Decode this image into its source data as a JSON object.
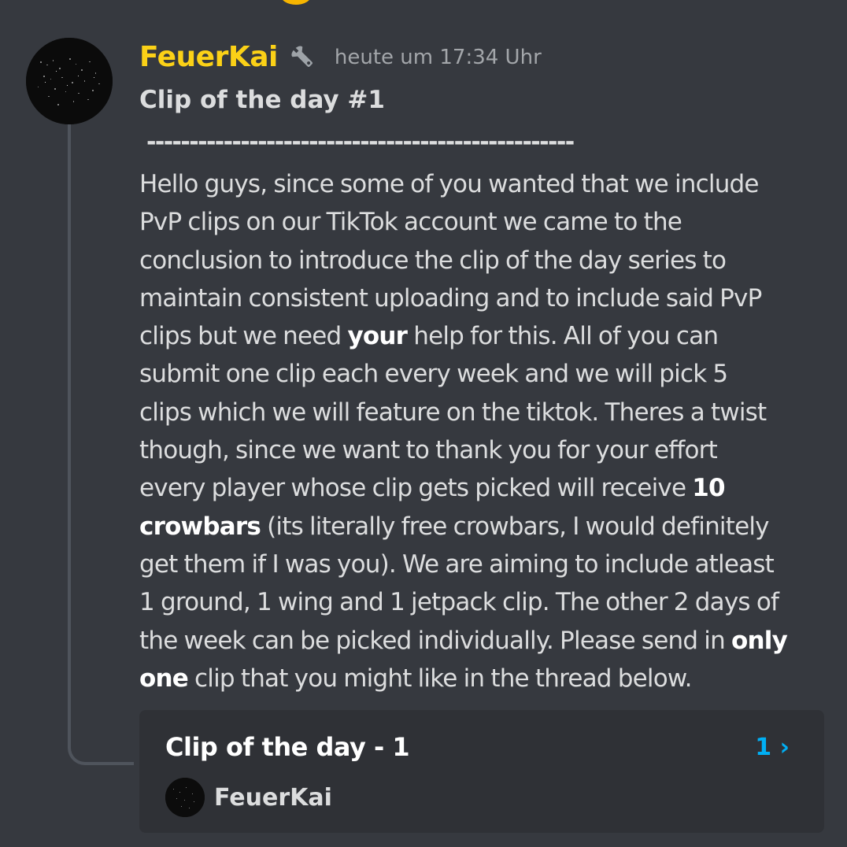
{
  "message": {
    "username": "FeuerKai",
    "role_icon": "wrench-icon",
    "timestamp": "heute um 17:34 Uhr",
    "title": "Clip of the day #1",
    "divider": "--------------------------------------------------",
    "lines": [
      [
        "Hello guys, since some of you wanted that we include"
      ],
      [
        "PvP clips on our TikTok account we came to the"
      ],
      [
        "conclusion to introduce the clip of the day series to"
      ],
      [
        "maintain consistent uploading and to include said PvP"
      ],
      [
        "clips but we need ",
        "your",
        " help for this. All of you can"
      ],
      [
        "submit one clip each every week and we will pick 5"
      ],
      [
        "clips which we will feature on the tiktok. Theres a twist"
      ],
      [
        "though, since we want to thank you for your effort"
      ],
      [
        "every player whose clip gets picked will receive ",
        "10"
      ],
      [
        "crowbars",
        " (its literally free crowbars, I would definitely"
      ],
      [
        "get them if I was you). We are aiming to include atleast"
      ],
      [
        "1 ground, 1 wing and 1 jetpack clip. The other 2 days of"
      ],
      [
        "the week can be picked individually. Please send in ",
        "only"
      ],
      [
        "one",
        " clip that you might like in the thread below."
      ]
    ],
    "bold_segments": [
      "your",
      "10",
      "crowbars",
      "only",
      "one"
    ]
  },
  "thread": {
    "title": "Clip of the day - 1",
    "count": "1",
    "arrow": "›",
    "author": "FeuerKai"
  },
  "colors": {
    "background": "#36393f",
    "username": "#fbd117",
    "text": "#dcddde",
    "timestamp": "#a3a6aa",
    "thread_card": "#2f3136",
    "link": "#00aff4"
  }
}
